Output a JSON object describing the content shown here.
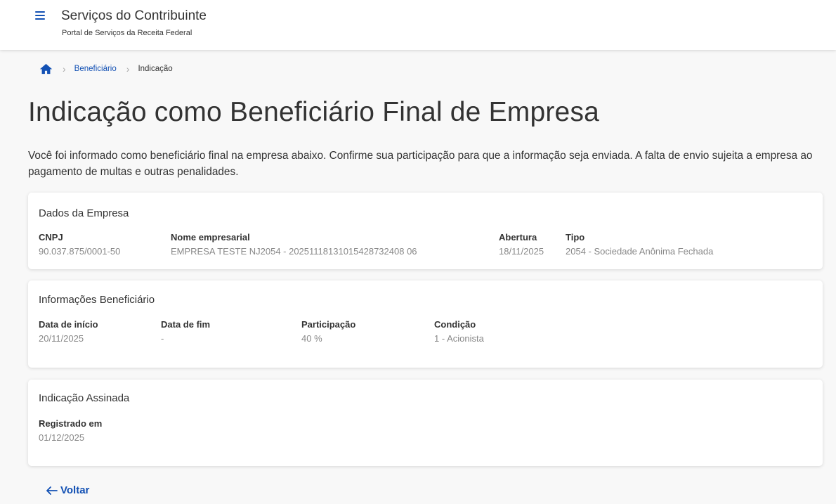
{
  "header": {
    "title": "Serviços do Contribuinte",
    "subtitle": "Portal de Serviços da Receita Federal"
  },
  "breadcrumb": {
    "items": [
      {
        "label": "Beneficiário"
      },
      {
        "label": "Indicação"
      }
    ]
  },
  "page": {
    "title": "Indicação como Beneficiário Final de Empresa",
    "intro": "Você foi informado como beneficiário final na empresa abaixo. Confirme sua participação para que a informação seja enviada. A falta de envio sujeita a empresa ao pagamento de multas e outras penalidades."
  },
  "empresa": {
    "title": "Dados da Empresa",
    "cnpj_label": "CNPJ",
    "cnpj": "90.037.875/0001-50",
    "nome_label": "Nome empresarial",
    "nome": "EMPRESA TESTE NJ2054 - 20251118131015428732408 06",
    "abertura_label": "Abertura",
    "abertura": "18/11/2025",
    "tipo_label": "Tipo",
    "tipo": "2054 - Sociedade Anônima Fechada"
  },
  "beneficiario": {
    "title": "Informações Beneficiário",
    "inicio_label": "Data de início",
    "inicio": "20/11/2025",
    "fim_label": "Data de fim",
    "fim": "-",
    "participacao_label": "Participação",
    "participacao": "40 %",
    "condicao_label": "Condição",
    "condicao": "1 - Acionista"
  },
  "assinada": {
    "title": "Indicação Assinada",
    "registrado_label": "Registrado em",
    "registrado": "01/12/2025"
  },
  "actions": {
    "back_label": "Voltar"
  },
  "icons": {
    "menu": "menu-icon",
    "home": "home-icon",
    "back": "arrow-left-icon",
    "separator": "chevron-right-icon"
  },
  "colors": {
    "accent": "#1351b4",
    "text": "#333333",
    "muted": "#888888",
    "background": "#f8f8f8"
  }
}
